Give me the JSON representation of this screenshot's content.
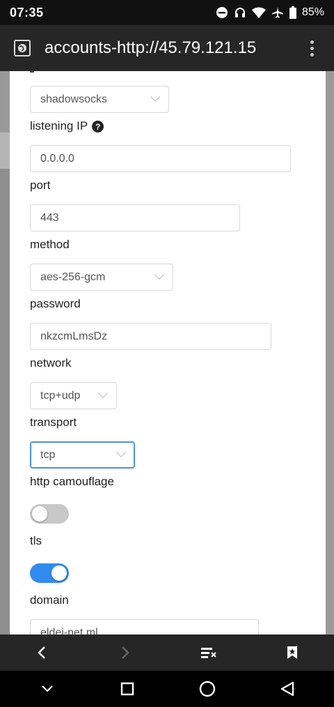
{
  "status": {
    "time": "07:35",
    "battery": "85%"
  },
  "browser": {
    "title": "accounts-http://45.79.121.15"
  },
  "form": {
    "protocol_value": "shadowsocks",
    "listening_ip_label": "listening IP",
    "listening_ip_value": "0.0.0.0",
    "port_label": "port",
    "port_value": "443",
    "method_label": "method",
    "method_value": "aes-256-gcm",
    "password_label": "password",
    "password_value": "nkzcmLmsDz",
    "network_label": "network",
    "network_value": "tcp+udp",
    "transport_label": "transport",
    "transport_value": "tcp",
    "http_camouflage_label": "http camouflage",
    "http_camouflage_on": false,
    "tls_label": "tls",
    "tls_on": true,
    "domain_label": "domain",
    "domain_value": "eldei-net.ml"
  },
  "colors": {
    "accent": "#2f8bf0",
    "toggle_off": "#c8c8c8",
    "chrome": "#262626"
  }
}
